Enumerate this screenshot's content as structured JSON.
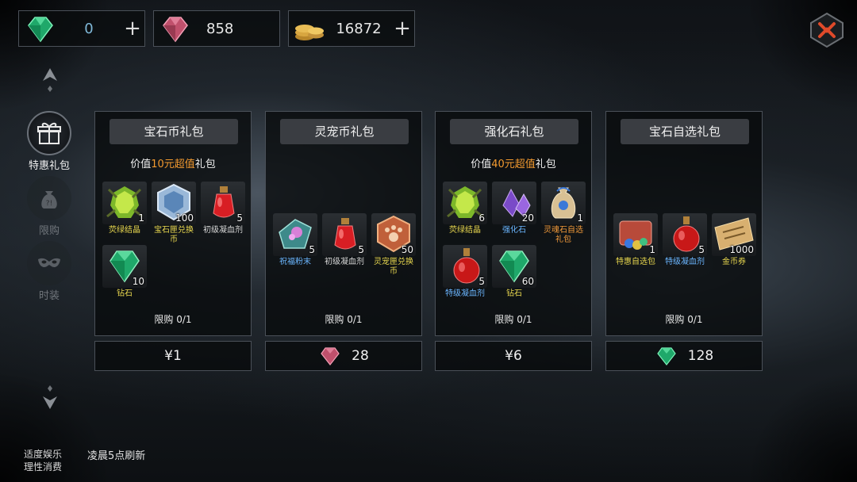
{
  "currencies": [
    {
      "icon": "green-gem-icon",
      "value": "0",
      "plus": "+"
    },
    {
      "icon": "pink-gem-icon",
      "value": "858"
    },
    {
      "icon": "gold-coins-icon",
      "value": "16872",
      "plus": "+"
    }
  ],
  "sidebar": [
    {
      "label": "特惠礼包",
      "icon": "gift-icon",
      "active": true
    },
    {
      "label": "限购",
      "icon": "money-bag-icon",
      "active": false
    },
    {
      "label": "时装",
      "icon": "mask-icon",
      "active": false
    }
  ],
  "packs": [
    {
      "title": "宝石币礼包",
      "value_line": {
        "prefix": "价值",
        "highlight": "10元超值",
        "suffix": "礼包"
      },
      "items": [
        {
          "name": "荧绿结晶",
          "count": "1",
          "color": "yellow",
          "icon": "green-crystal-icon"
        },
        {
          "name": "宝石匣兑换币",
          "count": "100",
          "color": "yellow",
          "icon": "gem-box-coin-icon"
        },
        {
          "name": "初级凝血剂",
          "count": "5",
          "color": "gray",
          "icon": "red-potion-icon"
        },
        {
          "name": "钻石",
          "count": "10",
          "color": "yellow",
          "icon": "green-diamond-icon"
        }
      ],
      "limit": "限购 0/1",
      "price": "¥1",
      "price_icon": ""
    },
    {
      "title": "灵宠币礼包",
      "value_line": null,
      "items": [
        {
          "name": "祝福粉末",
          "count": "5",
          "color": "blue",
          "icon": "blessing-powder-icon"
        },
        {
          "name": "初级凝血剂",
          "count": "5",
          "color": "gray",
          "icon": "red-potion-icon"
        },
        {
          "name": "灵宠匣兑换币",
          "count": "50",
          "color": "yellow",
          "icon": "pet-box-coin-icon"
        }
      ],
      "limit": "限购 0/1",
      "price": "28",
      "price_icon": "pink-gem-icon"
    },
    {
      "title": "强化石礼包",
      "value_line": {
        "prefix": "价值",
        "highlight": "40元超值",
        "suffix": "礼包"
      },
      "items": [
        {
          "name": "荧绿结晶",
          "count": "6",
          "color": "yellow",
          "icon": "green-crystal-icon"
        },
        {
          "name": "强化石",
          "count": "20",
          "color": "blue",
          "icon": "purple-stone-icon"
        },
        {
          "name": "灵魂石自选礼包",
          "count": "1",
          "color": "orange",
          "icon": "soul-stone-bag-icon"
        },
        {
          "name": "特级凝血剂",
          "count": "5",
          "color": "blue",
          "icon": "big-red-potion-icon"
        },
        {
          "name": "钻石",
          "count": "60",
          "color": "yellow",
          "icon": "green-diamond-icon"
        }
      ],
      "limit": "限购 0/1",
      "price": "¥6",
      "price_icon": ""
    },
    {
      "title": "宝石自选礼包",
      "value_line": null,
      "items": [
        {
          "name": "特惠自选包",
          "count": "1",
          "color": "yellow",
          "icon": "gem-select-pack-icon"
        },
        {
          "name": "特级凝血剂",
          "count": "5",
          "color": "blue",
          "icon": "big-red-potion-icon"
        },
        {
          "name": "金币券",
          "count": "1000",
          "color": "yellow",
          "icon": "gold-ticket-icon"
        }
      ],
      "limit": "限购 0/1",
      "price": "128",
      "price_icon": "green-gem-icon"
    }
  ],
  "footer": {
    "notice_line1": "适度娱乐",
    "notice_line2": "理性消费",
    "refresh": "凌晨5点刷新"
  },
  "colors": {
    "highlight": "#f39a2f",
    "item_yellow": "#e9d84f",
    "item_blue": "#6bb6ff",
    "item_orange": "#f29a3a"
  }
}
